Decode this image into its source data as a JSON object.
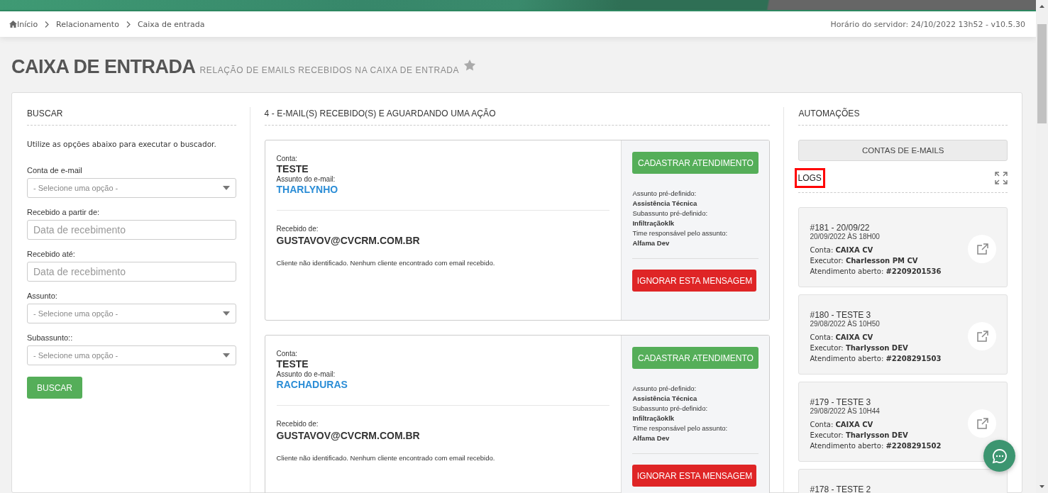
{
  "breadcrumb": [
    "Início",
    "Relacionamento",
    "Caixa de entrada"
  ],
  "server_time": "Horário do servidor: 24/10/2022 13h52 - v10.5.30",
  "page": {
    "title": "CAIXA DE ENTRADA",
    "subtitle": "RELAÇÃO DE EMAILS RECEBIDOS NA CAIXA DE ENTRADA",
    "favorite": false
  },
  "search": {
    "heading": "BUSCAR",
    "intro": "Utilize as opções abaixo para executar o buscador.",
    "fields": [
      {
        "label": "Conta de e-mail",
        "kind": "select",
        "placeholder": "- Selecione uma opção -"
      },
      {
        "label": "Recebido a partir de:",
        "kind": "date",
        "placeholder": "Data de recebimento"
      },
      {
        "label": "Recebido até:",
        "kind": "date",
        "placeholder": "Data de recebimento"
      },
      {
        "label": "Assunto:",
        "kind": "select",
        "placeholder": "- Selecione uma opção -"
      },
      {
        "label": "Subassunto::",
        "kind": "select",
        "placeholder": "- Selecione uma opção -"
      }
    ],
    "button": "BUSCAR"
  },
  "emails": {
    "heading": "4 - E-MAIL(S) RECEBIDO(S) E AGUARDANDO UMA AÇÃO",
    "items": [
      {
        "account_label": "Conta:",
        "account": "TESTE",
        "subject_label": "Assunto do e-mail:",
        "subject": "THARLYNHO",
        "from_label": "Recebido de:",
        "from": "GUSTAVOV@CVCRM.COM.BR",
        "client_note": "Cliente não identificado. Nenhum cliente encontrado com email recebido.",
        "register_button": "CADASTRAR ATENDIMENTO",
        "predefined": [
          {
            "label": "Assunto pré-definido:",
            "value": "Assistência Técnica"
          },
          {
            "label": "Subassunto pré-definido:",
            "value": "Infiltraçãoklk"
          },
          {
            "label": "Time responsável pelo assunto:",
            "value": "Alfama Dev"
          }
        ],
        "ignore_button": "IGNORAR ESTA MENSAGEM"
      },
      {
        "account_label": "Conta:",
        "account": "TESTE",
        "subject_label": "Assunto do e-mail:",
        "subject": "RACHADURAS",
        "from_label": "Recebido de:",
        "from": "GUSTAVOV@CVCRM.COM.BR",
        "client_note": "Cliente não identificado. Nenhum cliente encontrado com email recebido.",
        "register_button": "CADASTRAR ATENDIMENTO",
        "predefined": [
          {
            "label": "Assunto pré-definido:",
            "value": "Assistência Técnica"
          },
          {
            "label": "Subassunto pré-definido:",
            "value": "Infiltraçãoklk"
          },
          {
            "label": "Time responsável pelo assunto:",
            "value": "Alfama Dev"
          }
        ],
        "ignore_button": "IGNORAR ESTA MENSAGEM"
      }
    ]
  },
  "automations": {
    "heading": "AUTOMAÇÕES",
    "accounts_button": "CONTAS DE E-MAILS",
    "logs_heading": "LOGS",
    "logs": [
      {
        "title": "#181 - 20/09/22",
        "datetime": "20/09/2022 ÀS 18H00",
        "fields": [
          {
            "label": "Conta:",
            "value": "CAIXA CV"
          },
          {
            "label": "Executor:",
            "value": "Charlesson PM CV"
          },
          {
            "label": "Atendimento aberto:",
            "value": "#2209201536"
          }
        ]
      },
      {
        "title": "#180 - TESTE 3",
        "datetime": "29/08/2022 ÀS 10H50",
        "fields": [
          {
            "label": "Conta:",
            "value": "CAIXA CV"
          },
          {
            "label": "Executor:",
            "value": "Tharlysson DEV"
          },
          {
            "label": "Atendimento aberto:",
            "value": "#2208291503"
          }
        ]
      },
      {
        "title": "#179 - TESTE 3",
        "datetime": "29/08/2022 ÀS 10H44",
        "fields": [
          {
            "label": "Conta:",
            "value": "CAIXA CV"
          },
          {
            "label": "Executor:",
            "value": "Tharlysson DEV"
          },
          {
            "label": "Atendimento aberto:",
            "value": "#2208291502"
          }
        ]
      },
      {
        "title": "#178 - TESTE 2"
      }
    ]
  }
}
